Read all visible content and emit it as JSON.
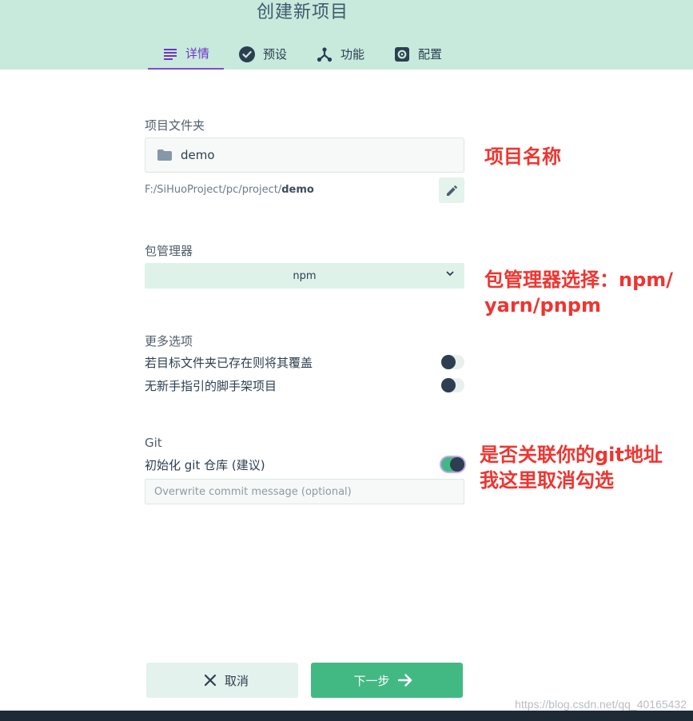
{
  "page": {
    "title": "创建新项目"
  },
  "tabs": [
    {
      "label": "详情",
      "icon": "list-icon",
      "active": true
    },
    {
      "label": "预设",
      "icon": "check-circle-icon",
      "active": false
    },
    {
      "label": "功能",
      "icon": "fork-icon",
      "active": false
    },
    {
      "label": "配置",
      "icon": "gear-icon",
      "active": false
    }
  ],
  "folder": {
    "label": "项目文件夹",
    "value": "demo",
    "path_prefix": "F:/SiHuoProject/pc/project/",
    "path_name": "demo"
  },
  "package_manager": {
    "label": "包管理器",
    "selected": "npm"
  },
  "more_options": {
    "label": "更多选项",
    "overwrite_label": "若目标文件夹已存在则将其覆盖",
    "overwrite_on": false,
    "no_guide_label": "无新手指引的脚手架项目",
    "no_guide_on": false
  },
  "git": {
    "label": "Git",
    "init_label": "初始化 git 仓库 (建议)",
    "init_on": true,
    "commit_placeholder": "Overwrite commit message (optional)"
  },
  "annotations": {
    "project_name": "项目名称",
    "pm_line1": "包管理器选择：npm/",
    "pm_line2": "yarn/pnpm",
    "git_line1": "是否关联你的git地址",
    "git_line2": "我这里取消勾选"
  },
  "actions": {
    "cancel_label": "取消",
    "next_label": "下一步"
  },
  "watermark": "https://blog.csdn.net/qq_40165432",
  "colors": {
    "header_bg": "#c8eadd",
    "accent_purple": "#6f34c8",
    "accent_green": "#42b983",
    "annotation_red": "#f0342f",
    "text_dark": "#2c3e50"
  }
}
